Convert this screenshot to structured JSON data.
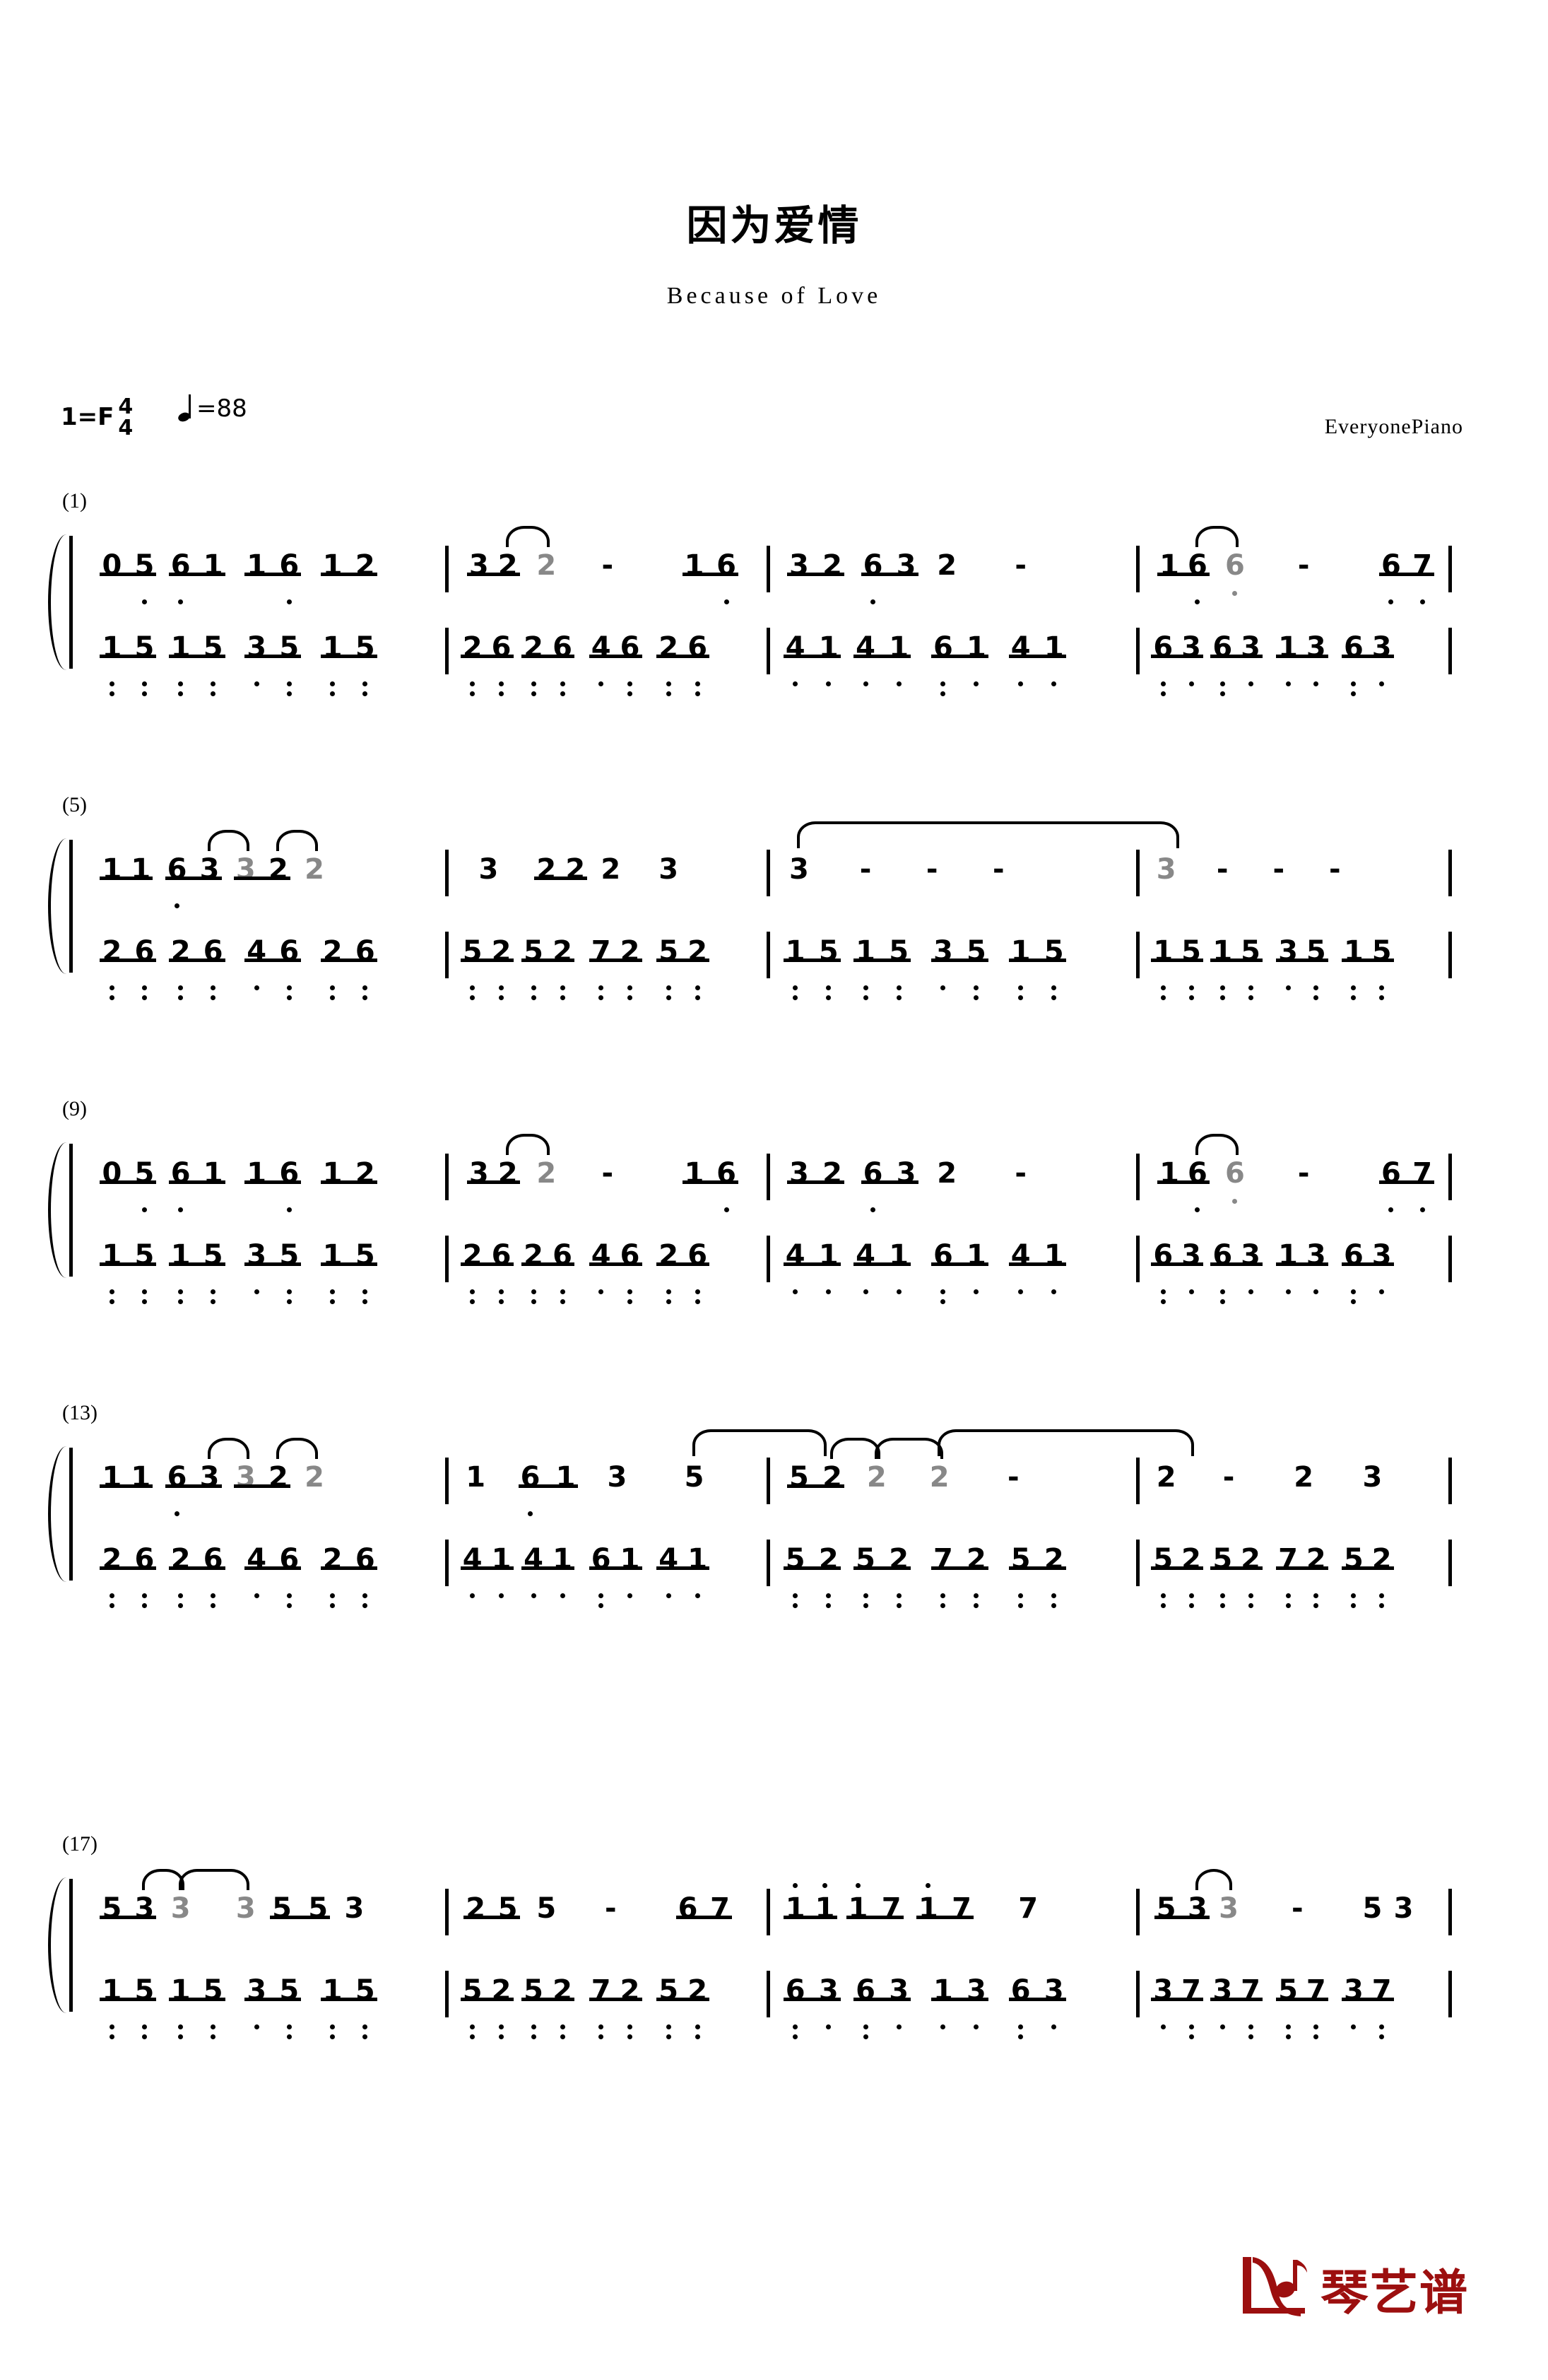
{
  "header": {
    "title": "因为爱情",
    "subtitle": "Because of Love",
    "key_label": "1=F",
    "time_num": "4",
    "time_den": "4",
    "tempo_text": "=88",
    "credit": "EveryonePiano"
  },
  "footer": {
    "logo_text": "琴艺谱"
  },
  "colors": {
    "ink": "#000000",
    "tied_note": "#888888",
    "logo_red": "#9c0f0f"
  },
  "chart_data": {
    "type": "table",
    "title": "因为爱情 — Because of Love (jianpu numbered notation)",
    "notation": "jianpu",
    "key": "1=F",
    "time_signature": "4/4",
    "tempo_bpm": 88,
    "systems": [
      {
        "label": "(1)",
        "measures": [
          {
            "number": 1,
            "melody": [
              "0",
              "5",
              "6",
              "1",
              "1",
              "6",
              "1",
              "2"
            ],
            "melody_octaves": [
              0,
              -1,
              -1,
              0,
              0,
              -1,
              0,
              0
            ],
            "bass": [
              "1",
              "5",
              "1",
              "5",
              "3",
              "5",
              "1",
              "5"
            ],
            "bass_octaves": [
              -2,
              -2,
              -2,
              -2,
              -1,
              -2,
              -2,
              -2
            ]
          },
          {
            "number": 2,
            "melody": [
              "3",
              "2",
              "2",
              "-",
              "1",
              "6"
            ],
            "melody_octaves": [
              0,
              0,
              0,
              0,
              0,
              -1
            ],
            "bass": [
              "2",
              "6",
              "2",
              "6",
              "4",
              "6",
              "2",
              "6"
            ],
            "bass_octaves": [
              -2,
              -2,
              -2,
              -2,
              -1,
              -2,
              -2,
              -2
            ]
          },
          {
            "number": 3,
            "melody": [
              "3",
              "2",
              "6",
              "3",
              "2",
              "-"
            ],
            "melody_octaves": [
              0,
              0,
              -1,
              0,
              0,
              0
            ],
            "bass": [
              "4",
              "1",
              "4",
              "1",
              "6",
              "1",
              "4",
              "1"
            ],
            "bass_octaves": [
              -1,
              -1,
              -1,
              -1,
              -2,
              -1,
              -1,
              -1
            ]
          },
          {
            "number": 4,
            "melody": [
              "1",
              "6",
              "6",
              "-",
              "6",
              "7"
            ],
            "melody_octaves": [
              0,
              -1,
              -1,
              0,
              -1,
              -1
            ],
            "bass": [
              "6",
              "3",
              "6",
              "3",
              "1",
              "3",
              "6",
              "3"
            ],
            "bass_octaves": [
              -2,
              -1,
              -2,
              -1,
              -1,
              -1,
              -2,
              -1
            ]
          }
        ]
      },
      {
        "label": "(5)",
        "measures": [
          {
            "number": 5,
            "melody": [
              "1",
              "1",
              "6",
              "3",
              "3",
              "2",
              "2"
            ],
            "melody_octaves": [
              0,
              0,
              -1,
              0,
              0,
              0,
              0
            ],
            "bass": [
              "2",
              "6",
              "2",
              "6",
              "4",
              "6",
              "2",
              "6"
            ],
            "bass_octaves": [
              -2,
              -2,
              -2,
              -2,
              -1,
              -2,
              -2,
              -2
            ]
          },
          {
            "number": 6,
            "melody": [
              "3",
              "2",
              "2",
              "2",
              "3"
            ],
            "melody_octaves": [
              0,
              0,
              0,
              0,
              0
            ],
            "bass": [
              "5",
              "2",
              "5",
              "2",
              "7",
              "2",
              "5",
              "2"
            ],
            "bass_octaves": [
              -2,
              -2,
              -2,
              -2,
              -2,
              -2,
              -2,
              -2
            ]
          },
          {
            "number": 7,
            "melody": [
              "3",
              "-",
              "-",
              "-"
            ],
            "melody_octaves": [
              0,
              0,
              0,
              0
            ],
            "bass": [
              "1",
              "5",
              "1",
              "5",
              "3",
              "5",
              "1",
              "5"
            ],
            "bass_octaves": [
              -2,
              -2,
              -2,
              -2,
              -1,
              -2,
              -2,
              -2
            ]
          },
          {
            "number": 8,
            "melody": [
              "3",
              "-",
              "-",
              "-"
            ],
            "melody_octaves": [
              0,
              0,
              0,
              0
            ],
            "bass": [
              "1",
              "5",
              "1",
              "5",
              "3",
              "5",
              "1",
              "5"
            ],
            "bass_octaves": [
              -2,
              -2,
              -2,
              -2,
              -1,
              -2,
              -2,
              -2
            ]
          }
        ]
      },
      {
        "label": "(9)",
        "measures": [
          {
            "number": 9,
            "melody": [
              "0",
              "5",
              "6",
              "1",
              "1",
              "6",
              "1",
              "2"
            ],
            "melody_octaves": [
              0,
              -1,
              -1,
              0,
              0,
              -1,
              0,
              0
            ],
            "bass": [
              "1",
              "5",
              "1",
              "5",
              "3",
              "5",
              "1",
              "5"
            ],
            "bass_octaves": [
              -2,
              -2,
              -2,
              -2,
              -1,
              -2,
              -2,
              -2
            ]
          },
          {
            "number": 10,
            "melody": [
              "3",
              "2",
              "2",
              "-",
              "1",
              "6"
            ],
            "melody_octaves": [
              0,
              0,
              0,
              0,
              0,
              -1
            ],
            "bass": [
              "2",
              "6",
              "2",
              "6",
              "4",
              "6",
              "2",
              "6"
            ],
            "bass_octaves": [
              -2,
              -2,
              -2,
              -2,
              -1,
              -2,
              -2,
              -2
            ]
          },
          {
            "number": 11,
            "melody": [
              "3",
              "2",
              "6",
              "3",
              "2",
              "-"
            ],
            "melody_octaves": [
              0,
              0,
              -1,
              0,
              0,
              0
            ],
            "bass": [
              "4",
              "1",
              "4",
              "1",
              "6",
              "1",
              "4",
              "1"
            ],
            "bass_octaves": [
              -1,
              -1,
              -1,
              -1,
              -2,
              -1,
              -1,
              -1
            ]
          },
          {
            "number": 12,
            "melody": [
              "1",
              "6",
              "6",
              "-",
              "6",
              "7"
            ],
            "melody_octaves": [
              0,
              -1,
              -1,
              0,
              -1,
              -1
            ],
            "bass": [
              "6",
              "3",
              "6",
              "3",
              "1",
              "3",
              "6",
              "3"
            ],
            "bass_octaves": [
              -2,
              -1,
              -2,
              -1,
              -1,
              -1,
              -2,
              -1
            ]
          }
        ]
      },
      {
        "label": "(13)",
        "measures": [
          {
            "number": 13,
            "melody": [
              "1",
              "1",
              "6",
              "3",
              "3",
              "2",
              "2"
            ],
            "melody_octaves": [
              0,
              0,
              -1,
              0,
              0,
              0,
              0
            ],
            "bass": [
              "2",
              "6",
              "2",
              "6",
              "4",
              "6",
              "2",
              "6"
            ],
            "bass_octaves": [
              -2,
              -2,
              -2,
              -2,
              -1,
              -2,
              -2,
              -2
            ]
          },
          {
            "number": 14,
            "melody": [
              "1",
              "6",
              "1",
              "3",
              "5"
            ],
            "melody_octaves": [
              0,
              -1,
              0,
              0,
              0
            ],
            "bass": [
              "4",
              "1",
              "4",
              "1",
              "6",
              "1",
              "4",
              "1"
            ],
            "bass_octaves": [
              -1,
              -1,
              -1,
              -1,
              -2,
              -1,
              -1,
              -1
            ]
          },
          {
            "number": 15,
            "melody": [
              "5",
              "2",
              "2",
              "2",
              "-"
            ],
            "melody_octaves": [
              0,
              0,
              0,
              0,
              0
            ],
            "bass": [
              "5",
              "2",
              "5",
              "2",
              "7",
              "2",
              "5",
              "2"
            ],
            "bass_octaves": [
              -2,
              -2,
              -2,
              -2,
              -2,
              -2,
              -2,
              -2
            ]
          },
          {
            "number": 16,
            "melody": [
              "2",
              "-",
              "2",
              "3"
            ],
            "melody_octaves": [
              0,
              0,
              0,
              0
            ],
            "bass": [
              "5",
              "2",
              "5",
              "2",
              "7",
              "2",
              "5",
              "2"
            ],
            "bass_octaves": [
              -2,
              -2,
              -2,
              -2,
              -2,
              -2,
              -2,
              -2
            ]
          }
        ]
      },
      {
        "label": "(17)",
        "measures": [
          {
            "number": 17,
            "melody": [
              "5",
              "3",
              "3",
              "3",
              "5",
              "5",
              "3"
            ],
            "melody_octaves": [
              0,
              0,
              0,
              0,
              0,
              0,
              0
            ],
            "bass": [
              "1",
              "5",
              "1",
              "5",
              "3",
              "5",
              "1",
              "5"
            ],
            "bass_octaves": [
              -2,
              -2,
              -2,
              -2,
              -1,
              -2,
              -2,
              -2
            ]
          },
          {
            "number": 18,
            "melody": [
              "2",
              "5",
              "5",
              "-",
              "6",
              "7"
            ],
            "melody_octaves": [
              0,
              0,
              0,
              0,
              0,
              0
            ],
            "bass": [
              "5",
              "2",
              "5",
              "2",
              "7",
              "2",
              "5",
              "2"
            ],
            "bass_octaves": [
              -2,
              -2,
              -2,
              -2,
              -2,
              -2,
              -2,
              -2
            ]
          },
          {
            "number": 19,
            "melody": [
              "1",
              "1",
              "1",
              "7",
              "1",
              "7",
              "7"
            ],
            "melody_octaves": [
              1,
              1,
              1,
              0,
              1,
              0,
              0
            ],
            "bass": [
              "6",
              "3",
              "6",
              "3",
              "1",
              "3",
              "6",
              "3"
            ],
            "bass_octaves": [
              -2,
              -1,
              -2,
              -1,
              -1,
              -1,
              -2,
              -1
            ]
          },
          {
            "number": 20,
            "melody": [
              "5",
              "3",
              "3",
              "-",
              "5",
              "3"
            ],
            "melody_octaves": [
              0,
              0,
              0,
              0,
              0,
              0
            ],
            "bass": [
              "3",
              "7",
              "3",
              "7",
              "5",
              "7",
              "3",
              "7"
            ],
            "bass_octaves": [
              -1,
              -2,
              -1,
              -2,
              -2,
              -2,
              -1,
              -2
            ]
          }
        ]
      }
    ]
  }
}
